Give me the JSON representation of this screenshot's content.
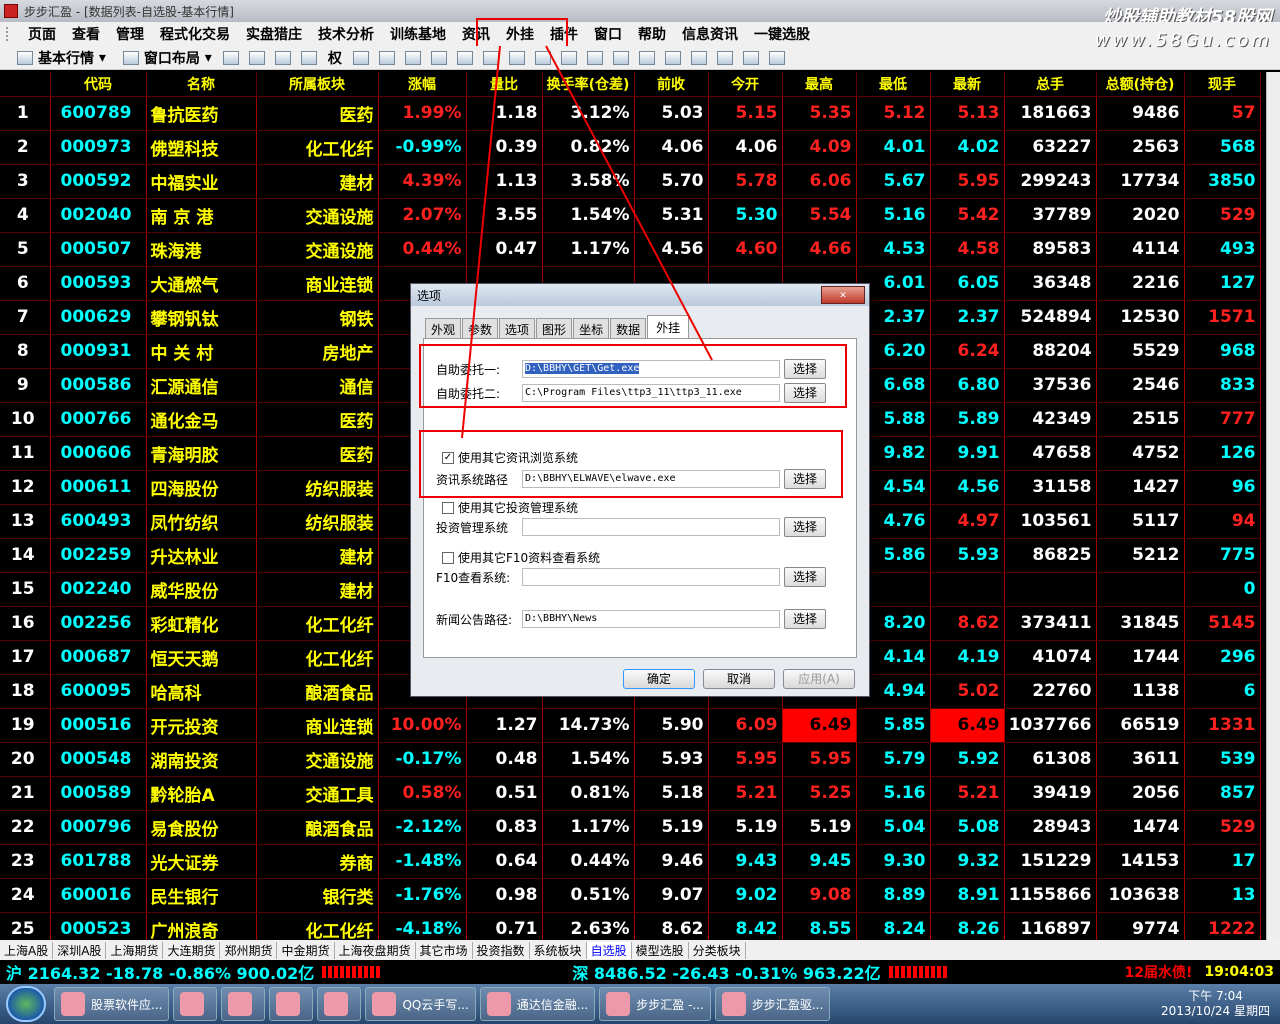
{
  "titlebar": {
    "title": "步步汇盈 - [数据列表-自选股-基本行情]",
    "watermark": "炒股辅助教材58股网",
    "watermark_url": "www.58Gu.com"
  },
  "menu": [
    "页面",
    "查看",
    "管理",
    "程式化交易",
    "实盘猎庄",
    "技术分析",
    "训练基地",
    "资讯",
    "外挂",
    "插件",
    "窗口",
    "帮助",
    "信息资讯",
    "一键选股"
  ],
  "toolbar": {
    "basic": "基本行情",
    "layout": "窗口布局",
    "rights": "权"
  },
  "columns": [
    "",
    "代码",
    "名称",
    "所属板块",
    "涨幅",
    "量比",
    "换手率(仓差)",
    "前收",
    "今开",
    "最高",
    "最低",
    "最新",
    "总手",
    "总额(持仓)",
    "现手"
  ],
  "rows": [
    [
      "1",
      "600789",
      "鲁抗医药",
      "医药",
      "1.99%",
      "1.18",
      "3.12%",
      "5.03",
      "5.15",
      "5.35",
      "5.12",
      "5.13",
      "181663",
      "9486",
      "57"
    ],
    [
      "2",
      "000973",
      "佛塑科技",
      "化工化纤",
      "-0.99%",
      "0.39",
      "0.82%",
      "4.06",
      "4.06",
      "4.09",
      "4.01",
      "4.02",
      "63227",
      "2563",
      "568"
    ],
    [
      "3",
      "000592",
      "中福实业",
      "建材",
      "4.39%",
      "1.13",
      "3.58%",
      "5.70",
      "5.78",
      "6.06",
      "5.67",
      "5.95",
      "299243",
      "17734",
      "3850"
    ],
    [
      "4",
      "002040",
      "南 京 港",
      "交通设施",
      "2.07%",
      "3.55",
      "1.54%",
      "5.31",
      "5.30",
      "5.54",
      "5.16",
      "5.42",
      "37789",
      "2020",
      "529"
    ],
    [
      "5",
      "000507",
      "珠海港",
      "交通设施",
      "0.44%",
      "0.47",
      "1.17%",
      "4.56",
      "4.60",
      "4.66",
      "4.53",
      "4.58",
      "89583",
      "4114",
      "493"
    ],
    [
      "6",
      "000593",
      "大通燃气",
      "商业连锁",
      "",
      "",
      "",
      "",
      "",
      "",
      "6.01",
      "6.05",
      "36348",
      "2216",
      "127"
    ],
    [
      "7",
      "000629",
      "攀钢钒钛",
      "钢铁",
      "",
      "",
      "",
      "",
      "",
      "",
      "2.37",
      "2.37",
      "524894",
      "12530",
      "1571"
    ],
    [
      "8",
      "000931",
      "中 关 村",
      "房地产",
      "",
      "",
      "",
      "",
      "",
      "",
      "6.20",
      "6.24",
      "88204",
      "5529",
      "968"
    ],
    [
      "9",
      "000586",
      "汇源通信",
      "通信",
      "",
      "",
      "",
      "",
      "",
      "",
      "6.68",
      "6.80",
      "37536",
      "2546",
      "833"
    ],
    [
      "10",
      "000766",
      "通化金马",
      "医药",
      "",
      "",
      "",
      "",
      "",
      "",
      "5.88",
      "5.89",
      "42349",
      "2515",
      "777"
    ],
    [
      "11",
      "000606",
      "青海明胶",
      "医药",
      "",
      "",
      "",
      "",
      "",
      "",
      "9.82",
      "9.91",
      "47658",
      "4752",
      "126"
    ],
    [
      "12",
      "000611",
      "四海股份",
      "纺织服装",
      "",
      "",
      "",
      "",
      "",
      "",
      "4.54",
      "4.56",
      "31158",
      "1427",
      "96"
    ],
    [
      "13",
      "600493",
      "凤竹纺织",
      "纺织服装",
      "",
      "",
      "",
      "",
      "",
      "",
      "4.76",
      "4.97",
      "103561",
      "5117",
      "94"
    ],
    [
      "14",
      "002259",
      "升达林业",
      "建材",
      "",
      "",
      "",
      "",
      "",
      "",
      "5.86",
      "5.93",
      "86825",
      "5212",
      "775"
    ],
    [
      "15",
      "002240",
      "威华股份",
      "建材",
      "",
      "",
      "",
      "",
      "",
      "",
      "",
      "",
      "",
      "",
      "0"
    ],
    [
      "16",
      "002256",
      "彩虹精化",
      "化工化纤",
      "",
      "",
      "",
      "",
      "",
      "",
      "8.20",
      "8.62",
      "373411",
      "31845",
      "5145"
    ],
    [
      "17",
      "000687",
      "恒天天鹅",
      "化工化纤",
      "",
      "",
      "",
      "",
      "",
      "",
      "4.14",
      "4.19",
      "41074",
      "1744",
      "296"
    ],
    [
      "18",
      "600095",
      "哈高科",
      "酿酒食品",
      "",
      "",
      "",
      "",
      "",
      "",
      "4.94",
      "5.02",
      "22760",
      "1138",
      "6"
    ],
    [
      "19",
      "000516",
      "开元投资",
      "商业连锁",
      "10.00%",
      "1.27",
      "14.73%",
      "5.90",
      "6.09",
      "6.49",
      "5.85",
      "6.49",
      "1037766",
      "66519",
      "1331"
    ],
    [
      "20",
      "000548",
      "湖南投资",
      "交通设施",
      "-0.17%",
      "0.48",
      "1.54%",
      "5.93",
      "5.95",
      "5.95",
      "5.79",
      "5.92",
      "61308",
      "3611",
      "539"
    ],
    [
      "21",
      "000589",
      "黔轮胎A",
      "交通工具",
      "0.58%",
      "0.51",
      "0.81%",
      "5.18",
      "5.21",
      "5.25",
      "5.16",
      "5.21",
      "39419",
      "2056",
      "857"
    ],
    [
      "22",
      "000796",
      "易食股份",
      "酿酒食品",
      "-2.12%",
      "0.83",
      "1.17%",
      "5.19",
      "5.19",
      "5.19",
      "5.04",
      "5.08",
      "28943",
      "1474",
      "529"
    ],
    [
      "23",
      "601788",
      "光大证券",
      "券商",
      "-1.48%",
      "0.64",
      "0.44%",
      "9.46",
      "9.43",
      "9.45",
      "9.30",
      "9.32",
      "151229",
      "14153",
      "17"
    ],
    [
      "24",
      "600016",
      "民生银行",
      "银行类",
      "-1.76%",
      "0.98",
      "0.51%",
      "9.07",
      "9.02",
      "9.08",
      "8.89",
      "8.91",
      "1155866",
      "103638",
      "13"
    ],
    [
      "25",
      "000523",
      "广州浪奇",
      "化工化纤",
      "-4.18%",
      "0.71",
      "2.63%",
      "8.62",
      "8.42",
      "8.55",
      "8.24",
      "8.26",
      "116897",
      "9774",
      "1222"
    ]
  ],
  "tabs": [
    "上海A股",
    "深圳A股",
    "上海期货",
    "大连期货",
    "郑州期货",
    "中金期货",
    "上海夜盘期货",
    "其它市场",
    "投资指数",
    "系统板块",
    "自选股",
    "模型选股",
    "分类板块"
  ],
  "active_tab": "自选股",
  "status": {
    "sh": "沪 2164.32 -18.78 -0.86% 900.02亿",
    "sz": "深 8486.52 -26.43 -0.31% 963.22亿",
    "alert": "12届水债!",
    "time": "19:04:03"
  },
  "dialog": {
    "title": "选项",
    "close": "✕",
    "tabs": [
      "外观",
      "参数",
      "选项",
      "图形",
      "坐标",
      "数据",
      "外挂"
    ],
    "active_tab": "外挂",
    "entrust1_label": "自助委托一:",
    "entrust1_value": "D:\\BBHY\\GET\\Get.exe",
    "entrust2_label": "自助委托二:",
    "entrust2_value": "C:\\Program Files\\ttp3_11\\ttp3_11.exe",
    "cb_news": "使用其它资讯浏览系统",
    "news_path_label": "资讯系统路径",
    "news_path_value": "D:\\BBHY\\ELWAVE\\elwave.exe",
    "cb_invest": "使用其它投资管理系统",
    "invest_label": "投资管理系统",
    "invest_value": "",
    "cb_f10": "使用其它F10资料查看系统",
    "f10_label": "F10查看系统:",
    "f10_value": "",
    "news_ann_label": "新闻公告路径:",
    "news_ann_value": "D:\\BBHY\\News",
    "choose": "选择",
    "ok": "确定",
    "cancel": "取消",
    "apply": "应用(A)"
  },
  "taskbar": {
    "items": [
      "股票软件应...",
      "",
      "",
      "",
      "",
      "QQ云手写...",
      "通达信金融...",
      "步步汇盈 -...",
      "步步汇盈驱..."
    ],
    "clock_time": "下午 7:04",
    "clock_date": "2013/10/24 星期四"
  }
}
